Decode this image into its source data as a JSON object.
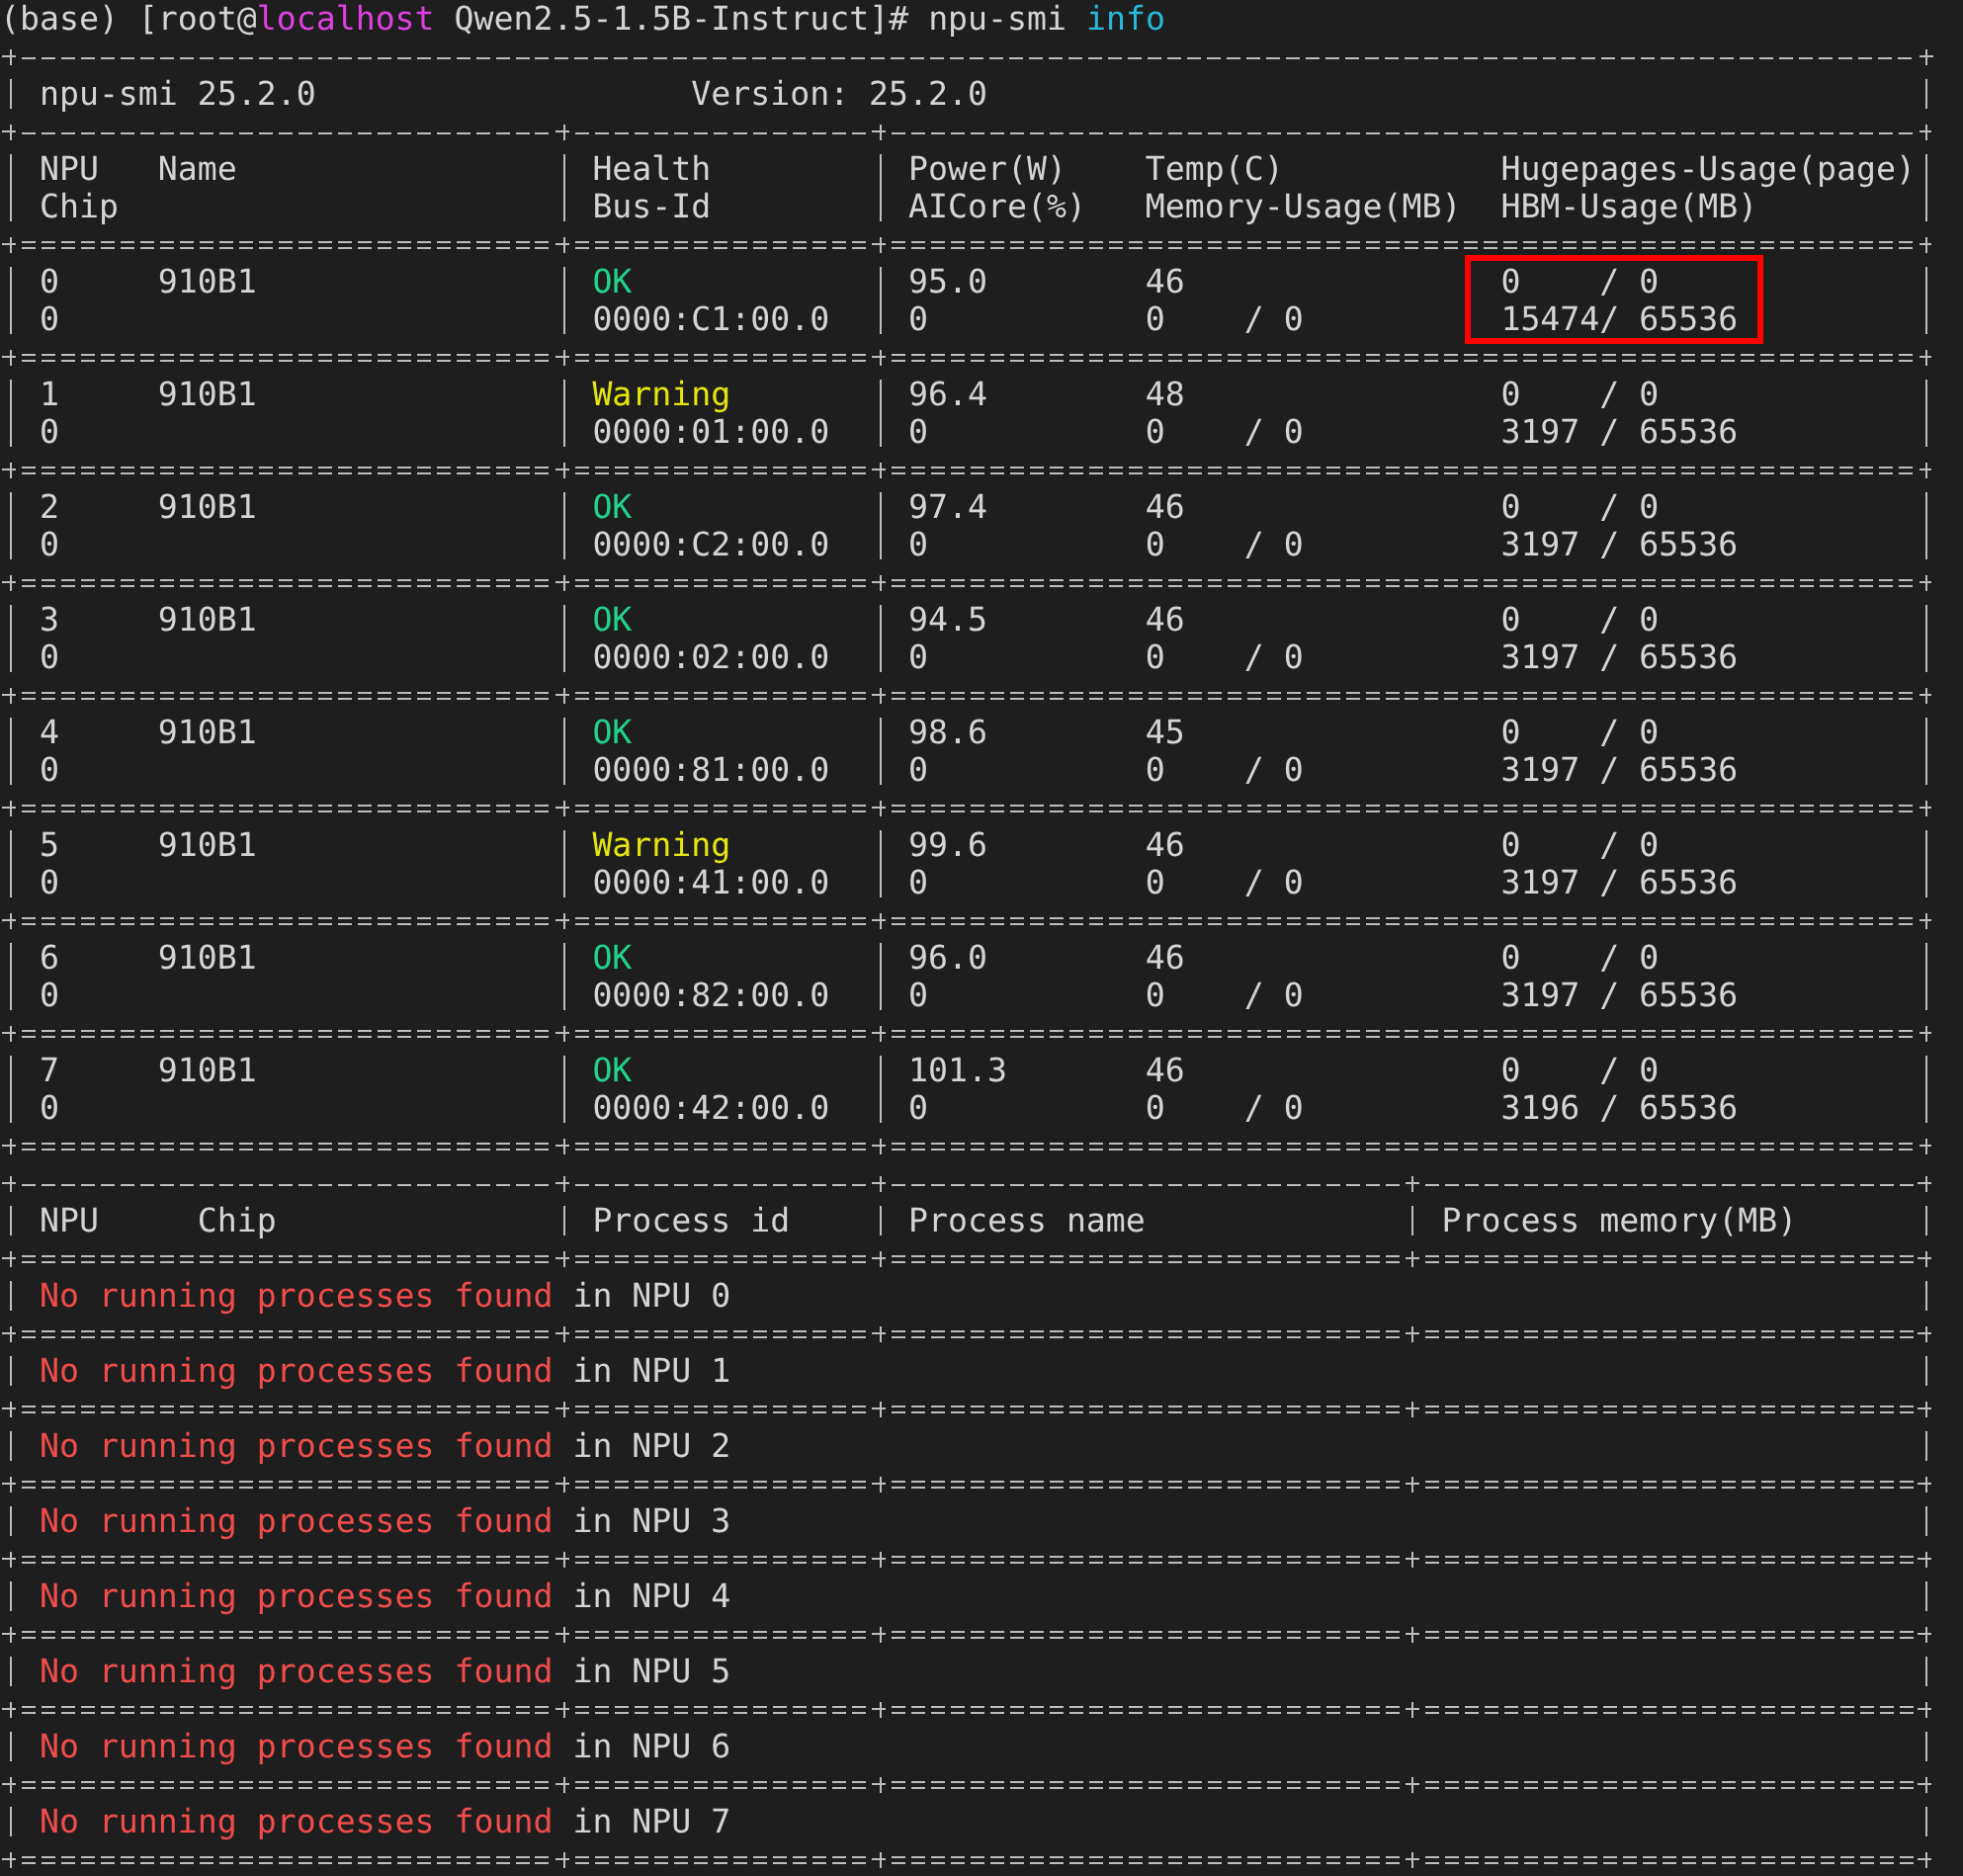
{
  "prompt": {
    "before": "(base) [root@",
    "host": "localhost",
    "after": " Qwen2.5-1.5B-Instruct]# ",
    "command": "npu-smi",
    "argument": "info"
  },
  "version": {
    "tool": "npu-smi 25.2.0",
    "version": "Version: 25.2.0"
  },
  "npu_columns": {
    "line1": [
      "NPU",
      "Name",
      "Health",
      "Power(W)",
      "Temp(C)",
      "Hugepages-Usage(page)"
    ],
    "line2": [
      "Chip",
      "Bus-Id",
      "AICore(%)",
      "Memory-Usage(MB)",
      "HBM-Usage(MB)"
    ]
  },
  "npus": [
    {
      "npu": "0",
      "name": "910B1",
      "health": "OK",
      "kind": "ok",
      "power": "95.0",
      "temp": "46",
      "hugepages": "0    / 0",
      "chip": "0",
      "bus_id": "0000:C1:00.0",
      "aicore": "0",
      "memory": "0    / 0",
      "hbm": "15474/ 65536",
      "highlighted": true
    },
    {
      "npu": "1",
      "name": "910B1",
      "health": "Warning",
      "kind": "warning",
      "power": "96.4",
      "temp": "48",
      "hugepages": "0    / 0",
      "chip": "0",
      "bus_id": "0000:01:00.0",
      "aicore": "0",
      "memory": "0    / 0",
      "hbm": "3197 / 65536",
      "highlighted": false
    },
    {
      "npu": "2",
      "name": "910B1",
      "health": "OK",
      "kind": "ok",
      "power": "97.4",
      "temp": "46",
      "hugepages": "0    / 0",
      "chip": "0",
      "bus_id": "0000:C2:00.0",
      "aicore": "0",
      "memory": "0    / 0",
      "hbm": "3197 / 65536",
      "highlighted": false
    },
    {
      "npu": "3",
      "name": "910B1",
      "health": "OK",
      "kind": "ok",
      "power": "94.5",
      "temp": "46",
      "hugepages": "0    / 0",
      "chip": "0",
      "bus_id": "0000:02:00.0",
      "aicore": "0",
      "memory": "0    / 0",
      "hbm": "3197 / 65536",
      "highlighted": false
    },
    {
      "npu": "4",
      "name": "910B1",
      "health": "OK",
      "kind": "ok",
      "power": "98.6",
      "temp": "45",
      "hugepages": "0    / 0",
      "chip": "0",
      "bus_id": "0000:81:00.0",
      "aicore": "0",
      "memory": "0    / 0",
      "hbm": "3197 / 65536",
      "highlighted": false
    },
    {
      "npu": "5",
      "name": "910B1",
      "health": "Warning",
      "kind": "warning",
      "power": "99.6",
      "temp": "46",
      "hugepages": "0    / 0",
      "chip": "0",
      "bus_id": "0000:41:00.0",
      "aicore": "0",
      "memory": "0    / 0",
      "hbm": "3197 / 65536",
      "highlighted": false
    },
    {
      "npu": "6",
      "name": "910B1",
      "health": "OK",
      "kind": "ok",
      "power": "96.0",
      "temp": "46",
      "hugepages": "0    / 0",
      "chip": "0",
      "bus_id": "0000:82:00.0",
      "aicore": "0",
      "memory": "0    / 0",
      "hbm": "3197 / 65536",
      "highlighted": false
    },
    {
      "npu": "7",
      "name": "910B1",
      "health": "OK",
      "kind": "ok",
      "power": "101.3",
      "temp": "46",
      "hugepages": "0    / 0",
      "chip": "0",
      "bus_id": "0000:42:00.0",
      "aicore": "0",
      "memory": "0    / 0",
      "hbm": "3196 / 65536",
      "highlighted": false
    }
  ],
  "process_columns": [
    "NPU",
    "Chip",
    "Process id",
    "Process name",
    "Process memory(MB)"
  ],
  "processes": [
    {
      "message": "No running processes found",
      "suffix": " in NPU 0"
    },
    {
      "message": "No running processes found",
      "suffix": " in NPU 1"
    },
    {
      "message": "No running processes found",
      "suffix": " in NPU 2"
    },
    {
      "message": "No running processes found",
      "suffix": " in NPU 3"
    },
    {
      "message": "No running processes found",
      "suffix": " in NPU 4"
    },
    {
      "message": "No running processes found",
      "suffix": " in NPU 5"
    },
    {
      "message": "No running processes found",
      "suffix": " in NPU 6"
    },
    {
      "message": "No running processes found",
      "suffix": " in NPU 7"
    }
  ]
}
